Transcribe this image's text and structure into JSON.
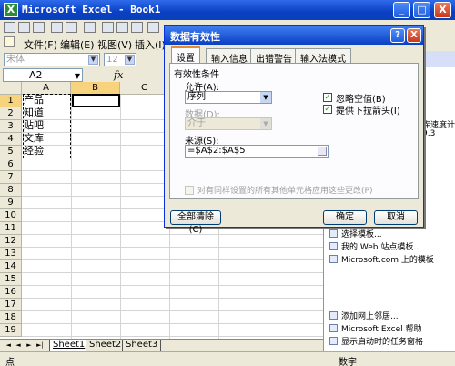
{
  "excel": {
    "title": "Microsoft Excel - Book1",
    "app_icon": "X",
    "window_buttons": {
      "minimize": "_",
      "maximize": "□",
      "close": "X"
    },
    "menu": [
      "文件(F)",
      "编辑(E)",
      "视图(V)",
      "插入(I)"
    ],
    "font_name": "宋体",
    "font_size": "12",
    "name_box": "A2",
    "fx": "fx",
    "columns": [
      "A",
      "B",
      "C"
    ],
    "rows": [
      "1",
      "2",
      "3",
      "4",
      "5",
      "6",
      "7",
      "8",
      "9",
      "10",
      "11",
      "12",
      "13",
      "14",
      "15",
      "16",
      "17",
      "18",
      "19",
      "20",
      "21",
      "22",
      "23",
      "24",
      "25",
      "26",
      "27",
      "28",
      "29",
      "30",
      "31",
      "32",
      "33",
      "34",
      "35",
      "36",
      "37",
      "38",
      "39",
      "40",
      "41",
      "42",
      "43",
      "44",
      "45",
      "46",
      "47",
      "48",
      "49",
      "50",
      "51",
      "52",
      "53",
      "54",
      "55",
      "56",
      "57",
      "58",
      "59",
      "60",
      "61",
      "62",
      "63",
      "64",
      "65",
      "66",
      "67",
      "68",
      "69",
      "70",
      "71",
      "72",
      "73",
      "74",
      "75",
      "76",
      "77",
      "78",
      "79",
      "80",
      "81",
      "82",
      "83",
      "84",
      "85",
      "86",
      "87",
      "88",
      "89",
      "90",
      "91",
      "92",
      "93",
      "94",
      "95",
      "96",
      "97",
      "98",
      "99",
      "100",
      "101",
      "102",
      "103",
      "104",
      "105",
      "106",
      "107",
      "108",
      "109",
      "110",
      "111",
      "112",
      "113",
      "114",
      "115",
      "116",
      "117",
      "118",
      "119",
      "120",
      "121",
      "122",
      "123",
      "124",
      "125",
      "126",
      "127",
      "128",
      "129",
      "130",
      "131",
      "132",
      "133",
      "134",
      "135",
      "136",
      "137",
      "138",
      "139",
      "140",
      "141",
      "142",
      "143",
      "144",
      "145",
      "146",
      "147",
      "148",
      "149",
      "150",
      "151",
      "152",
      "153",
      "154",
      "155",
      "156",
      "157",
      "158",
      "159",
      "160",
      "161",
      "162",
      "163",
      "164",
      "165",
      "166",
      "167",
      "168",
      "169",
      "170",
      "171",
      "172",
      "173",
      "174",
      "175",
      "176",
      "177",
      "178",
      "179",
      "180",
      "181",
      "182",
      "183",
      "184",
      "185",
      "186",
      "187",
      "188",
      "189",
      "190",
      "191",
      "192",
      "193",
      "194",
      "195",
      "196",
      "197",
      "198",
      "199",
      "200",
      "201",
      "202",
      "203",
      "204",
      "205",
      "206",
      "207",
      "208",
      "209",
      "210",
      "211",
      "212",
      "213",
      "214",
      "215",
      "216",
      "217",
      "218",
      "219",
      "220",
      "221",
      "222",
      "223",
      "224",
      "225",
      "226",
      "227",
      "228",
      "229",
      "230",
      "231",
      "232",
      "233",
      "234",
      "235",
      "236",
      "237",
      "238",
      "239",
      "240",
      "241",
      "242",
      "243",
      "244",
      "245",
      "246",
      "247",
      "248",
      "249",
      "250",
      "251",
      "252",
      "253",
      "254",
      "255",
      "256",
      "257",
      "258",
      "259",
      "260",
      "261",
      "262",
      "263",
      "264",
      "265",
      "266",
      "267",
      "268",
      "269",
      "270",
      "271",
      "272",
      "273",
      "274",
      "275",
      "276",
      "277",
      "278",
      "279",
      "280",
      "281",
      "282",
      "283",
      "284",
      "285",
      "286",
      "287",
      "288",
      "289",
      "290",
      "291",
      "292",
      "293",
      "294",
      "295",
      "296",
      "297",
      "298",
      "299",
      "300",
      "301",
      "302",
      "303",
      "304",
      "305",
      "306",
      "307",
      "308",
      "309",
      "310",
      "311",
      "312",
      "313",
      "314",
      "315",
      "316",
      "317",
      "318",
      "319",
      "320",
      "321",
      "322",
      "323",
      "324",
      "325",
      "326",
      "327",
      "328",
      "329",
      "330",
      "331",
      "332",
      "333",
      "334",
      "335",
      "336",
      "337",
      "338",
      "339",
      "340",
      "341",
      "342",
      "343",
      "344",
      "345",
      "346",
      "347",
      "348",
      "349",
      "350",
      "351",
      "352",
      "353",
      "354",
      "355",
      "356",
      "357",
      "358",
      "359",
      "360",
      "361",
      "362",
      "363",
      "364",
      "365",
      "366",
      "367",
      "368",
      "369",
      "370",
      "371",
      "372",
      "373",
      "374",
      "375",
      "376",
      "377",
      "378",
      "379",
      "380",
      "381",
      "382",
      "383",
      "384",
      "385",
      "386",
      "387",
      "388",
      "389",
      "390",
      "391",
      "392",
      "393",
      "394",
      "395",
      "396",
      "397",
      "398",
      "399",
      "400"
    ],
    "cells_a": [
      "产品",
      "知道",
      "贴吧",
      "文库",
      "经验"
    ],
    "sheet_nav": [
      "|◄",
      "◄",
      "►",
      "►|"
    ],
    "sheets": [
      "Sheet1",
      "Sheet2",
      "Sheet3"
    ],
    "status_ready": "点",
    "status_num": "数字"
  },
  "taskpane": {
    "fragments": [
      "库速度计",
      "9.3"
    ],
    "links": [
      "选择模板...",
      "我的 Web 站点模板...",
      "Microsoft.com 上的模板",
      "添加网上邻居...",
      "Microsoft Excel 帮助",
      "显示启动时的任务窗格"
    ]
  },
  "dialog": {
    "title": "数据有效性",
    "help": "?",
    "close": "X",
    "tabs": [
      "设置",
      "输入信息",
      "出错警告",
      "输入法模式"
    ],
    "section": "有效性条件",
    "allow_label": "允许(A):",
    "allow_value": "序列",
    "data_label": "数据(D):",
    "data_value": "介于",
    "source_label": "来源(S):",
    "source_value": "=$A$2:$A$5",
    "ignore_blank": "忽略空值(B)",
    "in_cell_dropdown": "提供下拉箭头(I)",
    "apply_all": "对有同样设置的所有其他单元格应用这些更改(P)",
    "clear_all": "全部清除(C)",
    "ok": "确定",
    "cancel": "取消"
  }
}
